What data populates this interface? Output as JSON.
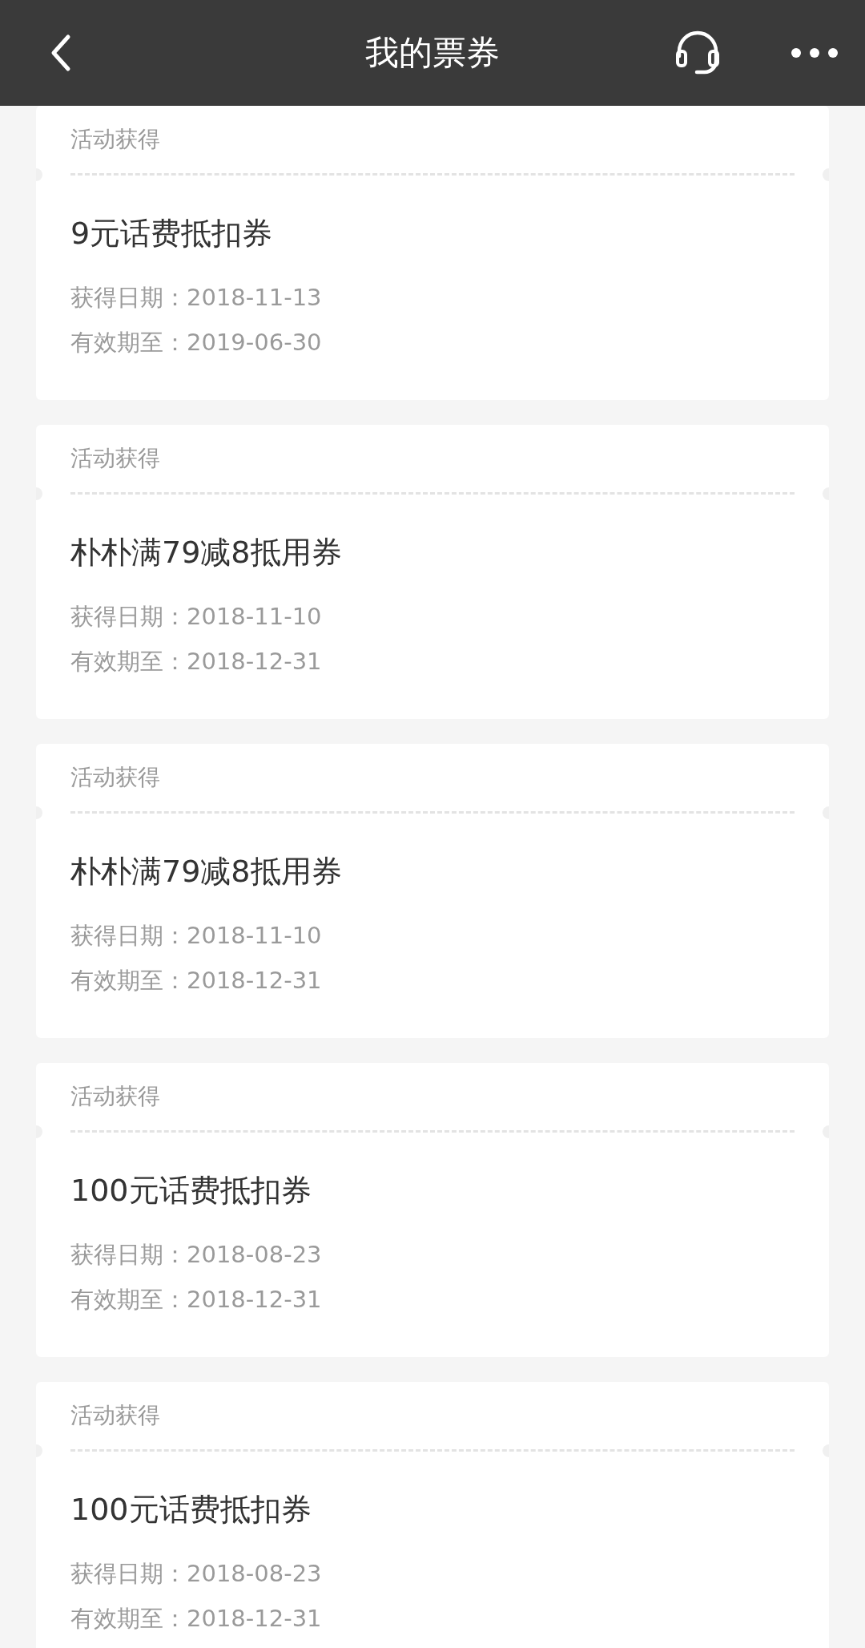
{
  "header": {
    "title": "我的票券"
  },
  "coupons": [
    {
      "source": "活动获得",
      "name": "9元话费抵扣券",
      "obtained": "获得日期：2018-11-13",
      "valid_until": "有效期至：2019-06-30"
    },
    {
      "source": "活动获得",
      "name": "朴朴满79减8抵用券",
      "obtained": "获得日期：2018-11-10",
      "valid_until": "有效期至：2018-12-31"
    },
    {
      "source": "活动获得",
      "name": "朴朴满79减8抵用券",
      "obtained": "获得日期：2018-11-10",
      "valid_until": "有效期至：2018-12-31"
    },
    {
      "source": "活动获得",
      "name": "100元话费抵扣券",
      "obtained": "获得日期：2018-08-23",
      "valid_until": "有效期至：2018-12-31"
    },
    {
      "source": "活动获得",
      "name": "100元话费抵扣券",
      "obtained": "获得日期：2018-08-23",
      "valid_until": "有效期至：2018-12-31"
    }
  ]
}
